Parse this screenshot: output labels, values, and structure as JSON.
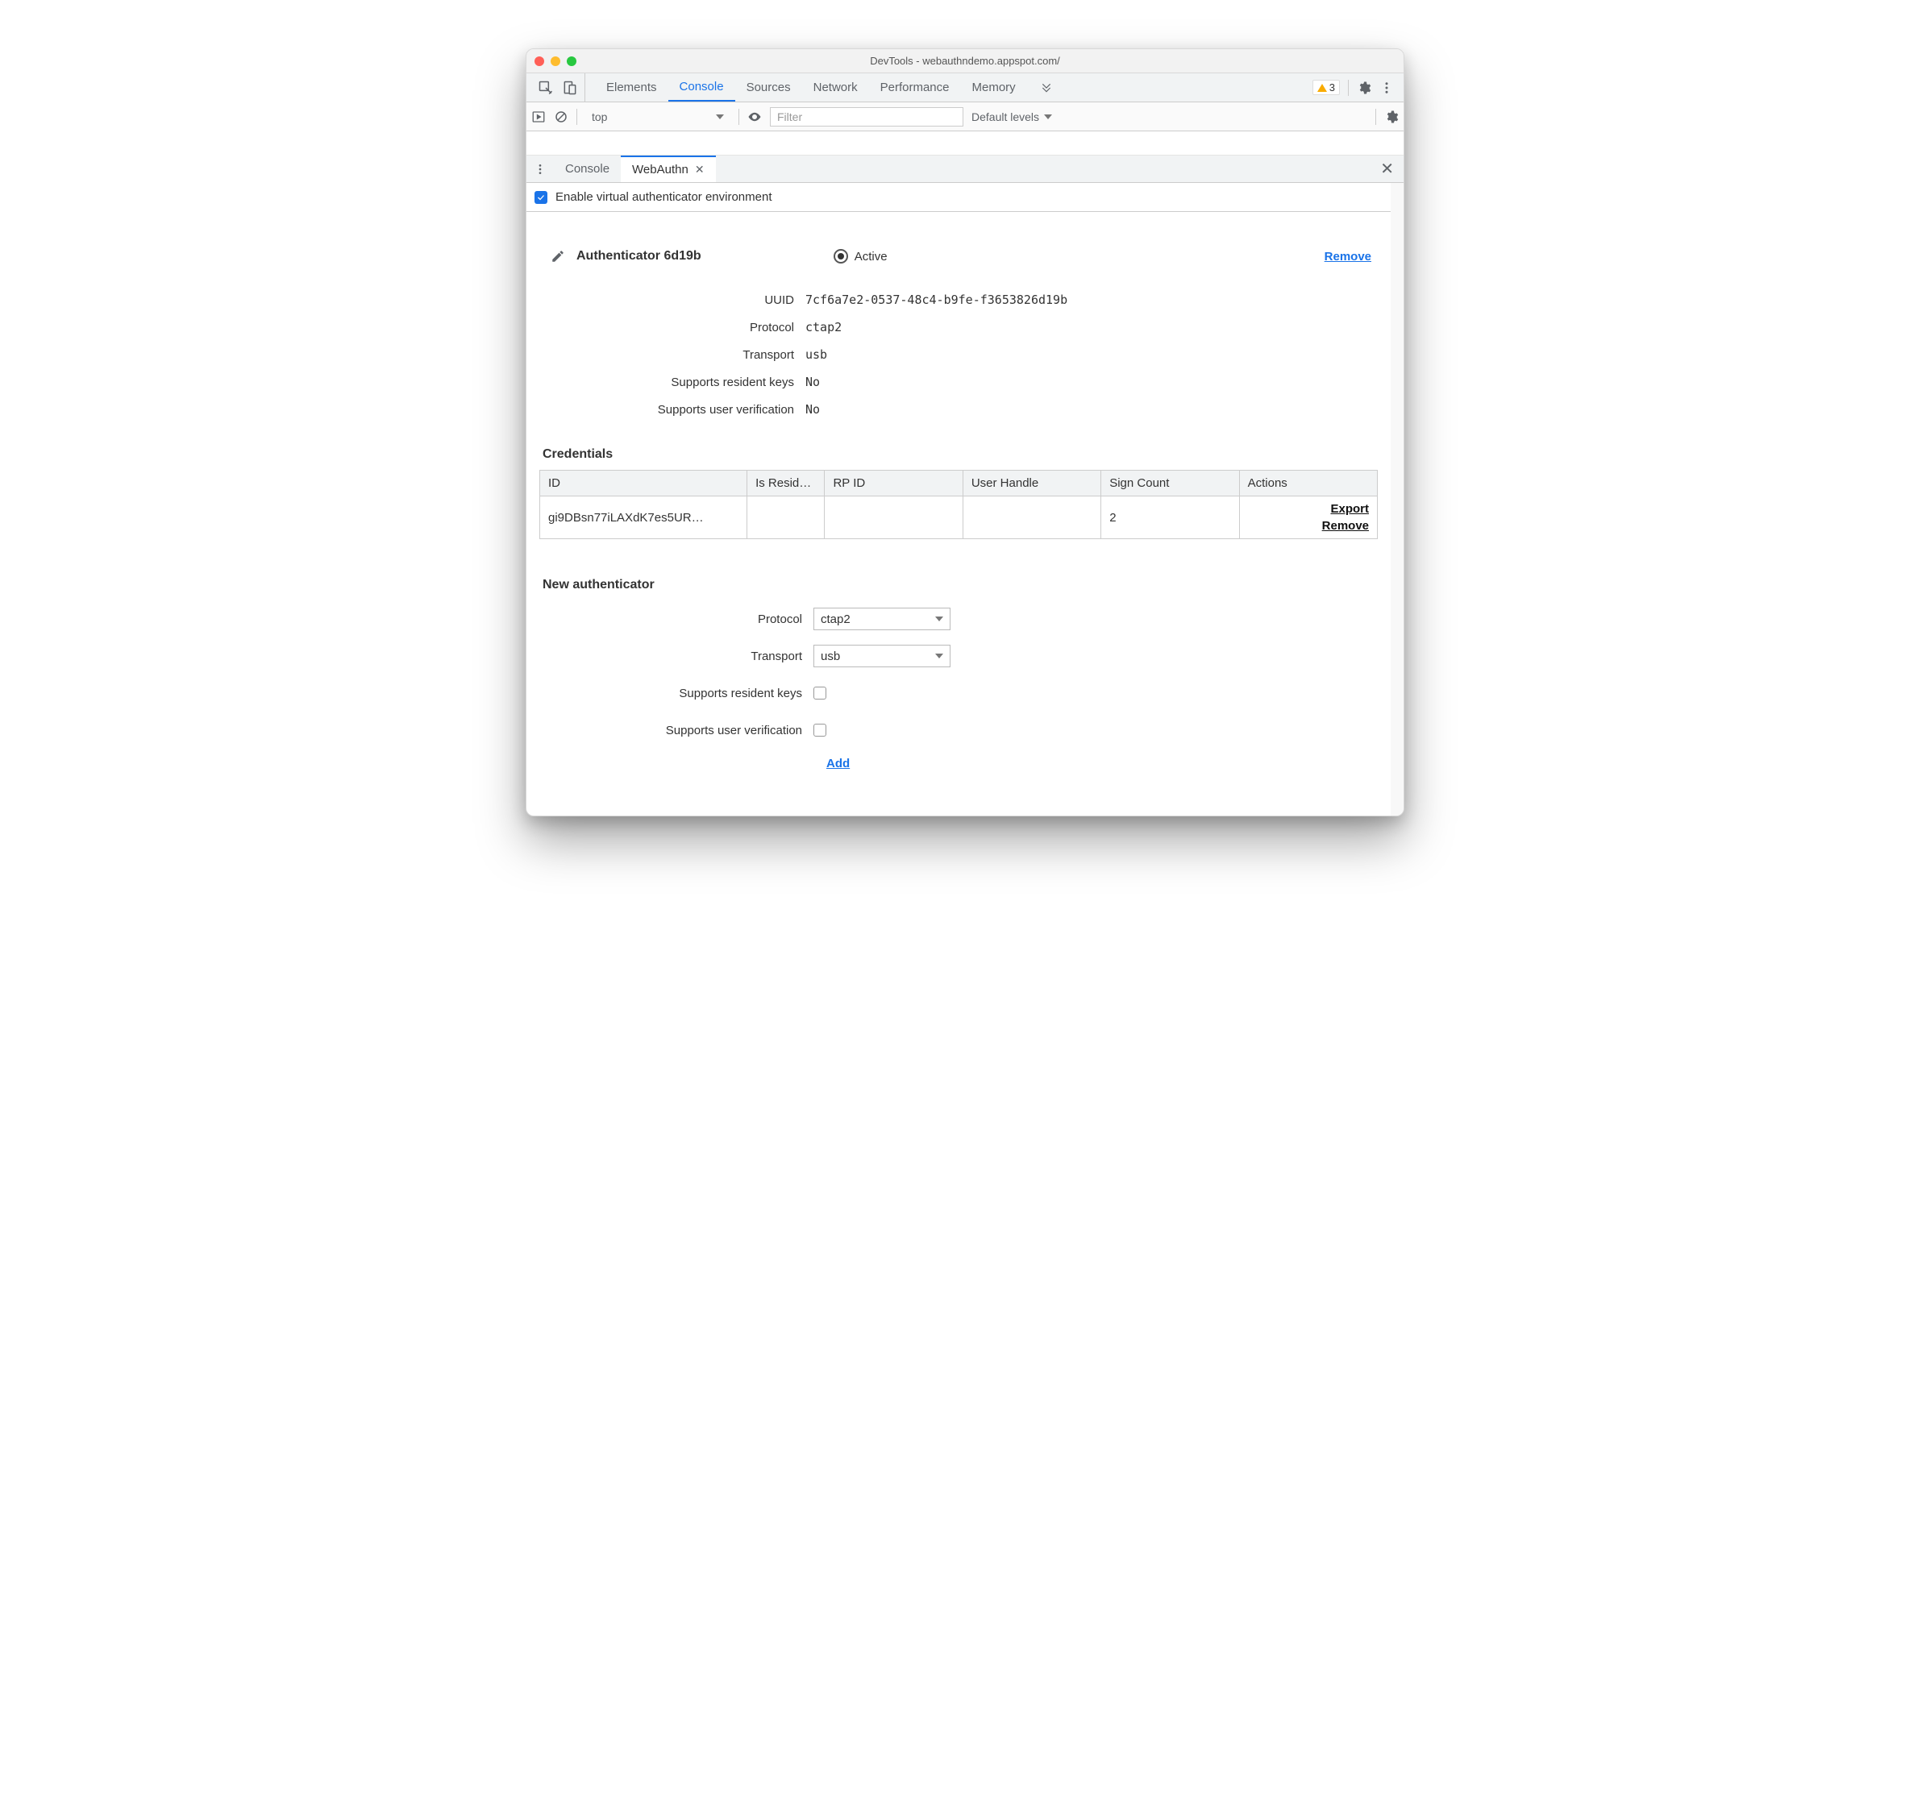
{
  "window": {
    "title": "DevTools - webauthndemo.appspot.com/"
  },
  "mainTabs": {
    "items": [
      "Elements",
      "Console",
      "Sources",
      "Network",
      "Performance",
      "Memory"
    ],
    "active": "Console"
  },
  "warnings": {
    "count": "3"
  },
  "consoleBar": {
    "context": "top",
    "filterPlaceholder": "Filter",
    "levels": "Default levels"
  },
  "drawer": {
    "tabs": [
      {
        "label": "Console",
        "active": false,
        "closable": false
      },
      {
        "label": "WebAuthn",
        "active": true,
        "closable": true
      }
    ]
  },
  "webauthn": {
    "enableLabel": "Enable virtual authenticator environment",
    "enabled": true,
    "authenticator": {
      "name": "Authenticator 6d19b",
      "activeLabel": "Active",
      "removeLabel": "Remove",
      "props": {
        "uuidLabel": "UUID",
        "uuid": "7cf6a7e2-0537-48c4-b9fe-f3653826d19b",
        "protocolLabel": "Protocol",
        "protocol": "ctap2",
        "transportLabel": "Transport",
        "transport": "usb",
        "residentLabel": "Supports resident keys",
        "resident": "No",
        "userVerifLabel": "Supports user verification",
        "userVerif": "No"
      }
    },
    "credentials": {
      "title": "Credentials",
      "columns": {
        "id": "ID",
        "isResident": "Is Resid…",
        "rp": "RP ID",
        "userHandle": "User Handle",
        "signCount": "Sign Count",
        "actions": "Actions"
      },
      "rows": [
        {
          "id": "gi9DBsn77iLAXdK7es5UR…",
          "isResident": "",
          "rp": "",
          "userHandle": "",
          "signCount": "2",
          "export": "Export",
          "remove": "Remove"
        }
      ]
    },
    "newAuth": {
      "title": "New authenticator",
      "protocolLabel": "Protocol",
      "protocol": "ctap2",
      "transportLabel": "Transport",
      "transport": "usb",
      "residentLabel": "Supports resident keys",
      "userVerifLabel": "Supports user verification",
      "addLabel": "Add"
    }
  }
}
